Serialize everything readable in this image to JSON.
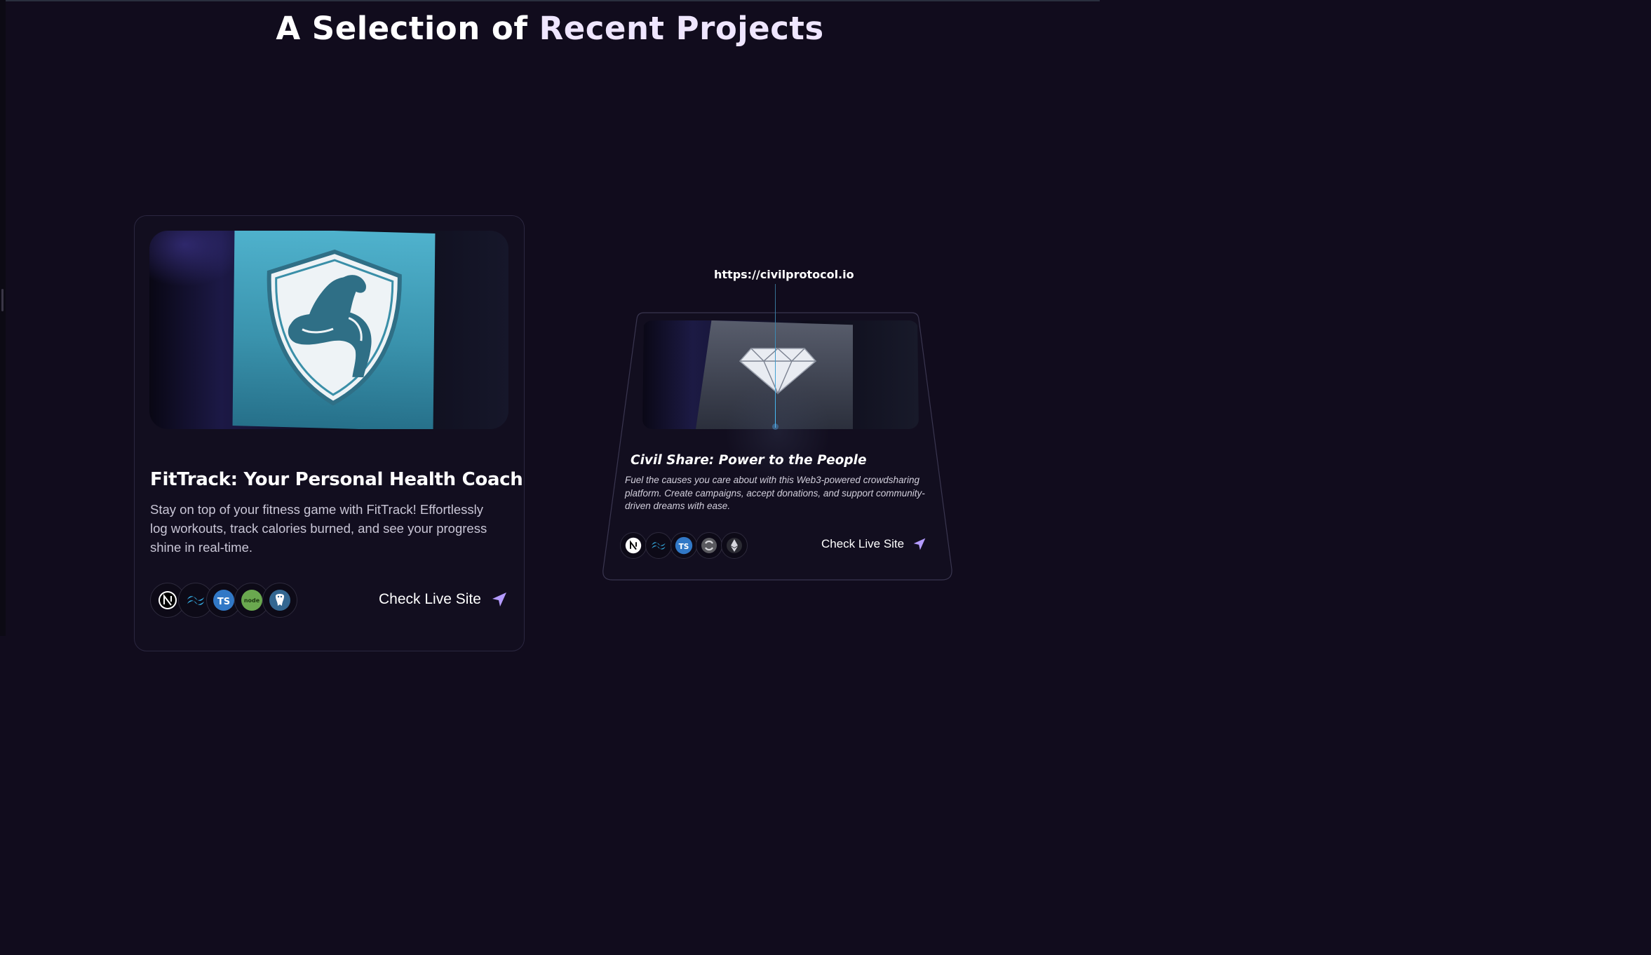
{
  "page": {
    "heading_part1": "A Selection of",
    "heading_accent": "Recent Projects"
  },
  "colors": {
    "background": "#110c1d",
    "accent": "#efe6ff",
    "send_icon": "#b49bff",
    "beam": "#4ac3ff"
  },
  "projects": [
    {
      "title": "FitTrack: Your Personal Health Coach",
      "description": "Stay on top of your fitness game with FitTrack! Effortlessly log workouts, track calories burned, and see your progress shine in real-time.",
      "cta": "Check Live Site",
      "image_icon": "flexed-arm-shield-icon",
      "tech_icons": [
        "nextjs-icon",
        "tailwind-icon",
        "typescript-icon",
        "nodejs-icon",
        "postgresql-icon"
      ]
    },
    {
      "url": "https://civilprotocol.io",
      "title": "Civil Share: Power to the People",
      "description": "Fuel the causes you care about with this Web3-powered crowdsharing platform. Create campaigns, accept donations, and support community-driven dreams with ease.",
      "cta": "Check Live Site",
      "image_icon": "diamond-icon",
      "tech_icons": [
        "nextjs-icon",
        "tailwind-icon",
        "typescript-icon",
        "thirdweb-icon",
        "ethereum-icon"
      ]
    }
  ],
  "tech_glyphs": {
    "typescript": "TS",
    "node": "node"
  }
}
